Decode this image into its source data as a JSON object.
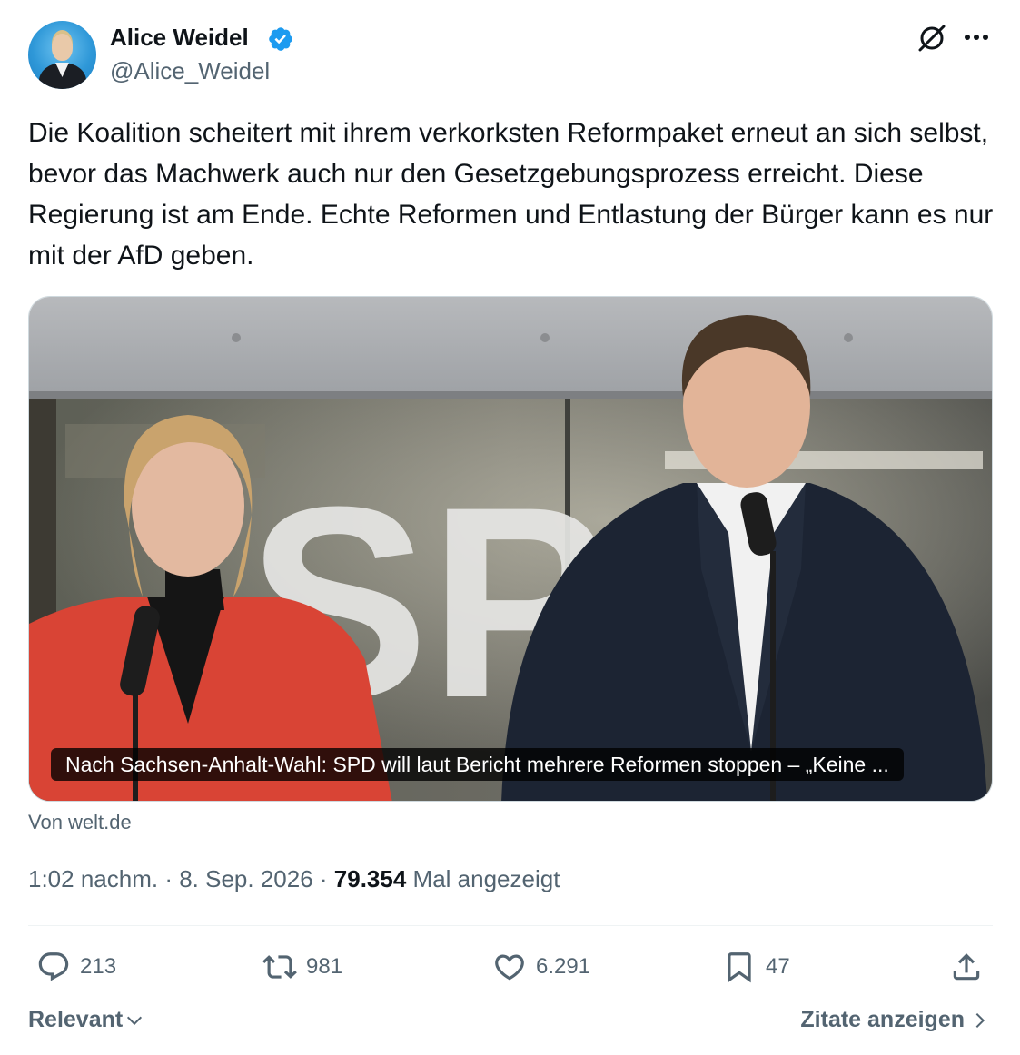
{
  "author": {
    "name": "Alice Weidel",
    "handle": "@Alice_Weidel",
    "verified": true
  },
  "tweet": {
    "text": "Die Koalition scheitert mit ihrem verkorksten Reformpaket erneut an sich selbst, bevor das Machwerk auch nur den Gesetzgebungsprozess erreicht. Diese Regierung ist am Ende. Echte Reformen und Entlastung der Bürger kann es nur mit der AfD geben."
  },
  "link_card": {
    "title": "Nach Sachsen-Anhalt-Wahl: SPD will laut Bericht mehrere Reformen stoppen – „Keine ...",
    "source": "Von welt.de"
  },
  "meta": {
    "time": "1:02 nachm.",
    "separator": " · ",
    "date": "8. Sep. 2026",
    "views_count": "79.354",
    "views_label": " Mal angezeigt"
  },
  "actions": {
    "replies": "213",
    "retweets": "981",
    "likes": "6.291",
    "bookmarks": "47"
  },
  "footer": {
    "sort_label": "Relevant",
    "quotes_label": "Zitate anzeigen"
  },
  "colors": {
    "accent": "#1d9bf0",
    "text_primary": "#0f1419",
    "text_secondary": "#536471"
  },
  "icons": [
    "verified-badge-icon",
    "grok-icon",
    "more-icon",
    "reply-icon",
    "retweet-icon",
    "like-icon",
    "bookmark-icon",
    "share-icon",
    "chevron-down-icon",
    "chevron-right-icon"
  ]
}
